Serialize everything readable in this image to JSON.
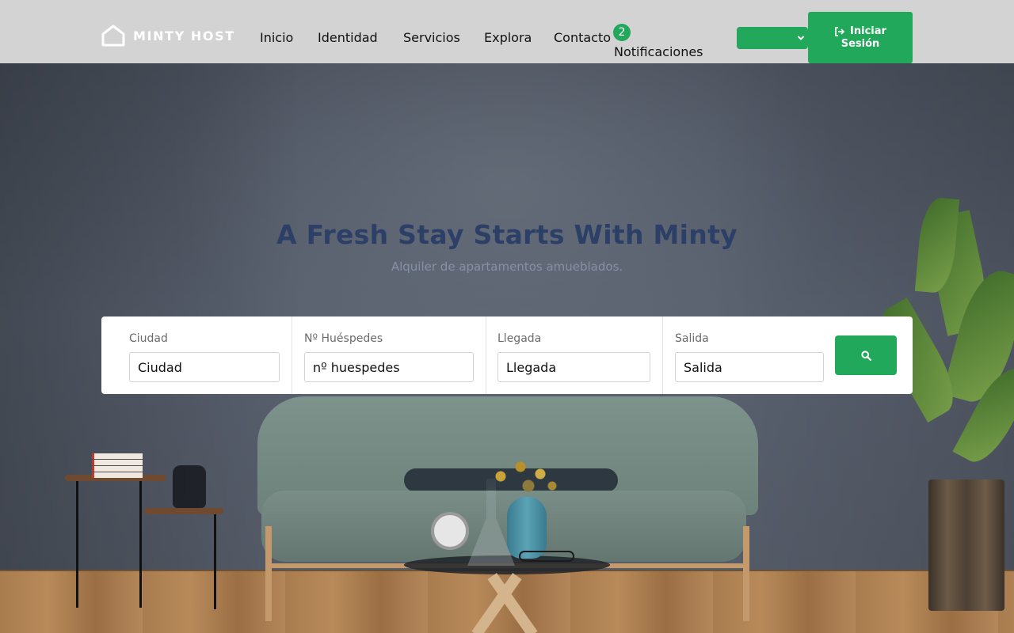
{
  "brand": {
    "name": "MINTY HOST",
    "logo_icon": "house-outline-icon"
  },
  "nav": {
    "items": [
      {
        "label": "Inicio"
      },
      {
        "label": "Identidad"
      },
      {
        "label": "Servicios"
      },
      {
        "label": "Explora"
      },
      {
        "label": "Contacto"
      }
    ],
    "notifications": {
      "count": "2",
      "label": "Notificaciones"
    },
    "language_select": {
      "value": "",
      "icon": "chevron-down-icon"
    },
    "login_button": {
      "line1": "Iniciar",
      "line2": "Sesión",
      "icon": "sign-in-icon"
    }
  },
  "hero": {
    "title": "A Fresh Stay Starts With Minty",
    "subtitle": "Alquiler de apartamentos amueblados."
  },
  "search": {
    "fields": [
      {
        "label": "Ciudad",
        "placeholder": "Ciudad"
      },
      {
        "label": "Nº Huéspedes",
        "placeholder": "nº huespedes"
      },
      {
        "label": "Llegada",
        "placeholder": "Llegada"
      },
      {
        "label": "Salida",
        "placeholder": "Salida"
      }
    ],
    "button_icon": "search-icon"
  },
  "colors": {
    "accent": "#22a85a",
    "header_bg": "#d3d3d3",
    "hero_title": "#2c3f66",
    "hero_subtitle": "#8791a6"
  }
}
